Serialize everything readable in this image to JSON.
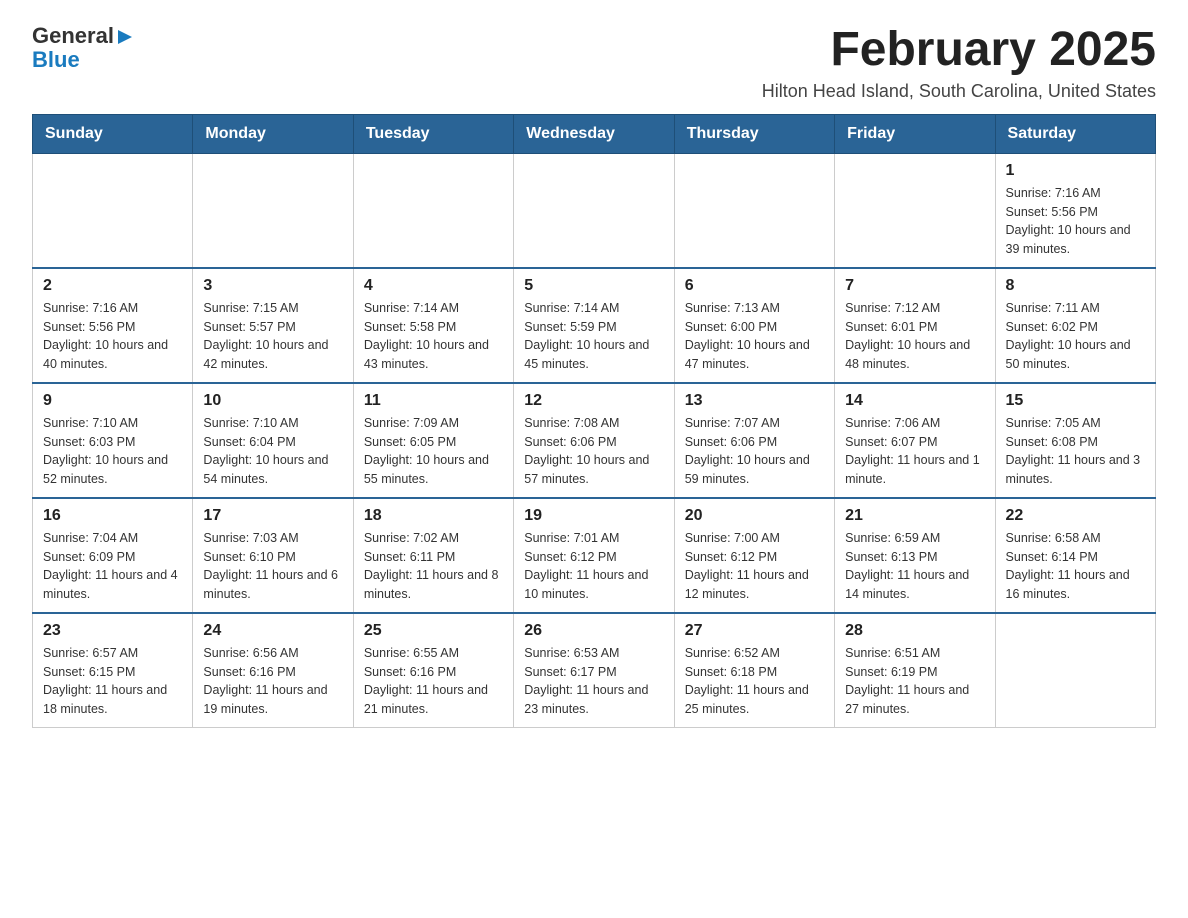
{
  "logo": {
    "general": "General",
    "blue": "Blue",
    "arrow": "▶"
  },
  "title": "February 2025",
  "subtitle": "Hilton Head Island, South Carolina, United States",
  "weekdays": [
    "Sunday",
    "Monday",
    "Tuesday",
    "Wednesday",
    "Thursday",
    "Friday",
    "Saturday"
  ],
  "weeks": [
    [
      {
        "day": "",
        "info": ""
      },
      {
        "day": "",
        "info": ""
      },
      {
        "day": "",
        "info": ""
      },
      {
        "day": "",
        "info": ""
      },
      {
        "day": "",
        "info": ""
      },
      {
        "day": "",
        "info": ""
      },
      {
        "day": "1",
        "info": "Sunrise: 7:16 AM\nSunset: 5:56 PM\nDaylight: 10 hours and 39 minutes."
      }
    ],
    [
      {
        "day": "2",
        "info": "Sunrise: 7:16 AM\nSunset: 5:56 PM\nDaylight: 10 hours and 40 minutes."
      },
      {
        "day": "3",
        "info": "Sunrise: 7:15 AM\nSunset: 5:57 PM\nDaylight: 10 hours and 42 minutes."
      },
      {
        "day": "4",
        "info": "Sunrise: 7:14 AM\nSunset: 5:58 PM\nDaylight: 10 hours and 43 minutes."
      },
      {
        "day": "5",
        "info": "Sunrise: 7:14 AM\nSunset: 5:59 PM\nDaylight: 10 hours and 45 minutes."
      },
      {
        "day": "6",
        "info": "Sunrise: 7:13 AM\nSunset: 6:00 PM\nDaylight: 10 hours and 47 minutes."
      },
      {
        "day": "7",
        "info": "Sunrise: 7:12 AM\nSunset: 6:01 PM\nDaylight: 10 hours and 48 minutes."
      },
      {
        "day": "8",
        "info": "Sunrise: 7:11 AM\nSunset: 6:02 PM\nDaylight: 10 hours and 50 minutes."
      }
    ],
    [
      {
        "day": "9",
        "info": "Sunrise: 7:10 AM\nSunset: 6:03 PM\nDaylight: 10 hours and 52 minutes."
      },
      {
        "day": "10",
        "info": "Sunrise: 7:10 AM\nSunset: 6:04 PM\nDaylight: 10 hours and 54 minutes."
      },
      {
        "day": "11",
        "info": "Sunrise: 7:09 AM\nSunset: 6:05 PM\nDaylight: 10 hours and 55 minutes."
      },
      {
        "day": "12",
        "info": "Sunrise: 7:08 AM\nSunset: 6:06 PM\nDaylight: 10 hours and 57 minutes."
      },
      {
        "day": "13",
        "info": "Sunrise: 7:07 AM\nSunset: 6:06 PM\nDaylight: 10 hours and 59 minutes."
      },
      {
        "day": "14",
        "info": "Sunrise: 7:06 AM\nSunset: 6:07 PM\nDaylight: 11 hours and 1 minute."
      },
      {
        "day": "15",
        "info": "Sunrise: 7:05 AM\nSunset: 6:08 PM\nDaylight: 11 hours and 3 minutes."
      }
    ],
    [
      {
        "day": "16",
        "info": "Sunrise: 7:04 AM\nSunset: 6:09 PM\nDaylight: 11 hours and 4 minutes."
      },
      {
        "day": "17",
        "info": "Sunrise: 7:03 AM\nSunset: 6:10 PM\nDaylight: 11 hours and 6 minutes."
      },
      {
        "day": "18",
        "info": "Sunrise: 7:02 AM\nSunset: 6:11 PM\nDaylight: 11 hours and 8 minutes."
      },
      {
        "day": "19",
        "info": "Sunrise: 7:01 AM\nSunset: 6:12 PM\nDaylight: 11 hours and 10 minutes."
      },
      {
        "day": "20",
        "info": "Sunrise: 7:00 AM\nSunset: 6:12 PM\nDaylight: 11 hours and 12 minutes."
      },
      {
        "day": "21",
        "info": "Sunrise: 6:59 AM\nSunset: 6:13 PM\nDaylight: 11 hours and 14 minutes."
      },
      {
        "day": "22",
        "info": "Sunrise: 6:58 AM\nSunset: 6:14 PM\nDaylight: 11 hours and 16 minutes."
      }
    ],
    [
      {
        "day": "23",
        "info": "Sunrise: 6:57 AM\nSunset: 6:15 PM\nDaylight: 11 hours and 18 minutes."
      },
      {
        "day": "24",
        "info": "Sunrise: 6:56 AM\nSunset: 6:16 PM\nDaylight: 11 hours and 19 minutes."
      },
      {
        "day": "25",
        "info": "Sunrise: 6:55 AM\nSunset: 6:16 PM\nDaylight: 11 hours and 21 minutes."
      },
      {
        "day": "26",
        "info": "Sunrise: 6:53 AM\nSunset: 6:17 PM\nDaylight: 11 hours and 23 minutes."
      },
      {
        "day": "27",
        "info": "Sunrise: 6:52 AM\nSunset: 6:18 PM\nDaylight: 11 hours and 25 minutes."
      },
      {
        "day": "28",
        "info": "Sunrise: 6:51 AM\nSunset: 6:19 PM\nDaylight: 11 hours and 27 minutes."
      },
      {
        "day": "",
        "info": ""
      }
    ]
  ]
}
